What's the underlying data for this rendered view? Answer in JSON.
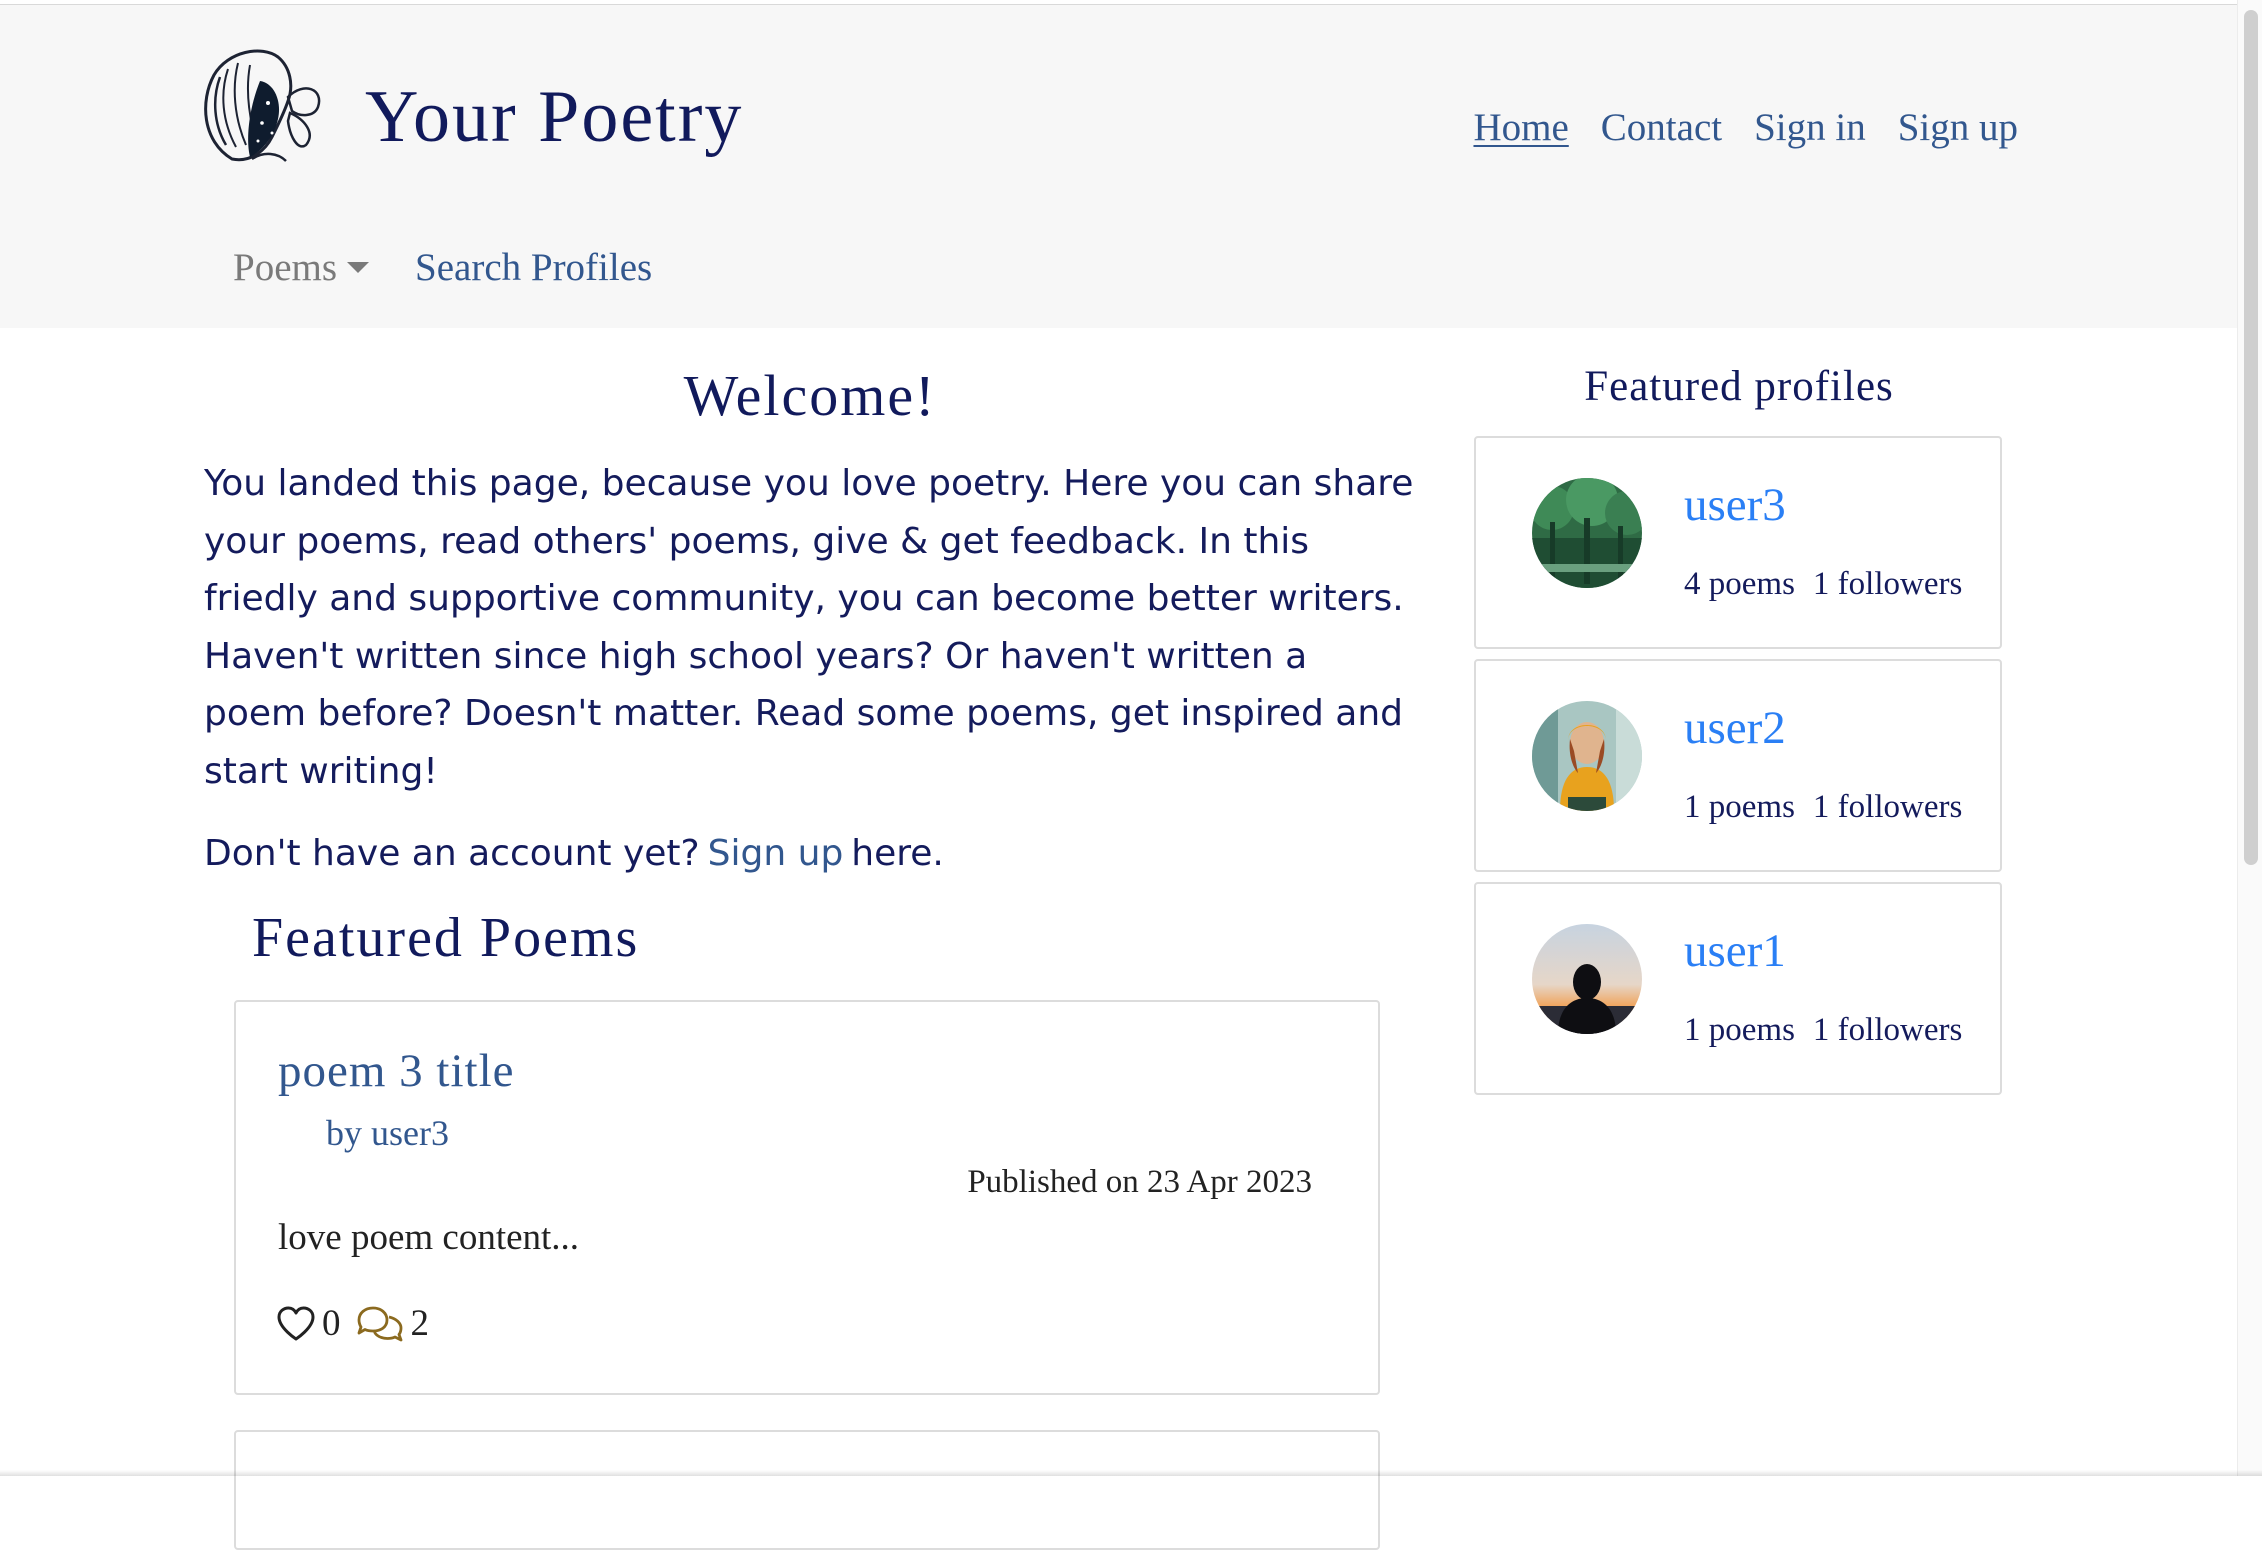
{
  "brand": {
    "name": "Your Poetry"
  },
  "nav": {
    "home": "Home",
    "contact": "Contact",
    "sign_in": "Sign in",
    "sign_up": "Sign up"
  },
  "subnav": {
    "poems": "Poems",
    "search_profiles": "Search Profiles"
  },
  "welcome": {
    "title": "Welcome!",
    "body": "You landed this page, because you love poetry. Here you can share your poems, read others' poems, give & get feedback. In this friedly and supportive community, you can become better writers. Haven't written since high school years? Or haven't written a poem before? Doesn't matter. Read some poems, get inspired and start writing!",
    "signup_prefix": "Don't have an account yet?",
    "signup_link": "Sign up",
    "signup_suffix": "here."
  },
  "featured_poems": {
    "heading": "Featured Poems",
    "items": [
      {
        "title": "poem 3 title",
        "author": "by user3",
        "published": "Published on 23 Apr 2023",
        "excerpt": "love poem content...",
        "likes": "0",
        "comments": "2",
        "icons": {
          "like": "heart-outline-icon",
          "comment": "chat-bubbles-icon"
        }
      }
    ]
  },
  "featured_profiles": {
    "heading": "Featured profiles",
    "items": [
      {
        "username": "user3",
        "poems": "4 poems",
        "followers": "1 followers",
        "avatar": "forest-avatar"
      },
      {
        "username": "user2",
        "poems": "1 poems",
        "followers": "1 followers",
        "avatar": "woman-yellow-hoodie-avatar"
      },
      {
        "username": "user1",
        "poems": "1 poems",
        "followers": "1 followers",
        "avatar": "silhouette-sunset-avatar"
      }
    ]
  },
  "colors": {
    "header_bg": "#f7f7f7",
    "heading_navy": "#111a5c",
    "link_blue": "#32578e",
    "profile_link": "#2a7ff5",
    "comment_icon": "#8b6a1f"
  }
}
